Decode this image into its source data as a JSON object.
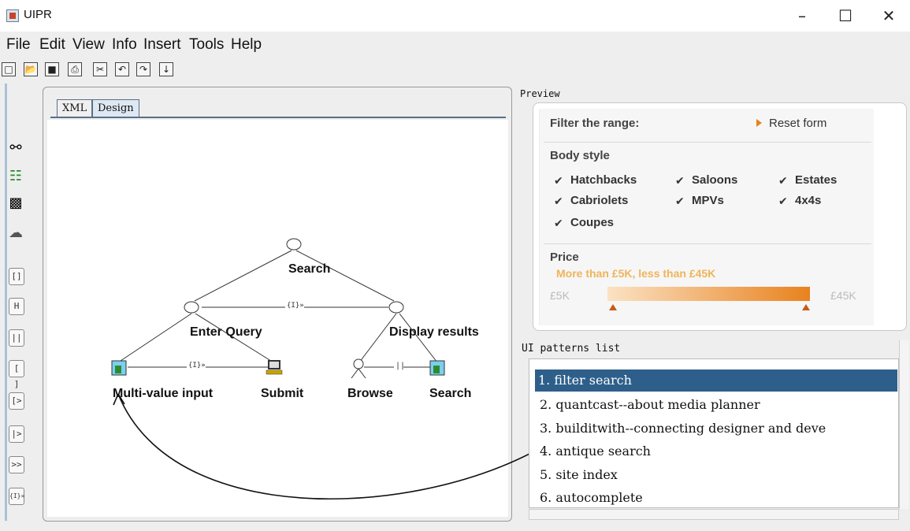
{
  "window": {
    "title": "UIPR",
    "minimize": "–",
    "maximize": "☐",
    "close": "✕"
  },
  "menu": [
    "File",
    "Edit",
    "View",
    "Info",
    "Insert",
    "Tools",
    "Help"
  ],
  "toolbar": {
    "icons": [
      "new-icon",
      "open-icon",
      "save-icon",
      "print-icon",
      "cut-icon",
      "undo-icon",
      "redo-icon",
      "down-arrow-icon"
    ],
    "glyphs": [
      "□",
      "📂",
      "■",
      "⎙",
      "✂",
      "↶",
      "↷",
      "↓"
    ]
  },
  "palette": {
    "buttons": [
      "[]",
      "H",
      "||",
      "[ ]",
      "[>",
      "|>",
      ">>",
      "{I}»"
    ]
  },
  "design": {
    "tabs": [
      "XML",
      "Design"
    ],
    "active_tab": "Design",
    "nodes": {
      "root": "Search",
      "left": "Enter Query",
      "right": "Display results",
      "leaf1": "Multi-value input",
      "leaf2": "Submit",
      "leaf3": "Browse",
      "leaf4": "Search"
    },
    "edge_markers": {
      "mid": "{I}»",
      "left": "{I}»",
      "right": "||"
    }
  },
  "preview": {
    "label": "Preview",
    "filter_title": "Filter the range:",
    "reset": "Reset form",
    "body_style": "Body style",
    "options": [
      [
        "Hatchbacks",
        "Saloons",
        "Estates"
      ],
      [
        "Cabriolets",
        "MPVs",
        "4x4s"
      ],
      [
        "Coupes"
      ]
    ],
    "price": "Price",
    "price_range_text": "More than £5K, less than £45K",
    "price_min": "£5K",
    "price_max": "£45K",
    "accent": "#e8821e"
  },
  "patterns": {
    "label": "UI patterns list",
    "items": [
      "1. filter search",
      "2. quantcast--about media planner",
      "3. builditwith--connecting designer and deve",
      "4. antique search",
      "5. site index",
      "6. autocomplete"
    ],
    "selected_index": 0
  }
}
